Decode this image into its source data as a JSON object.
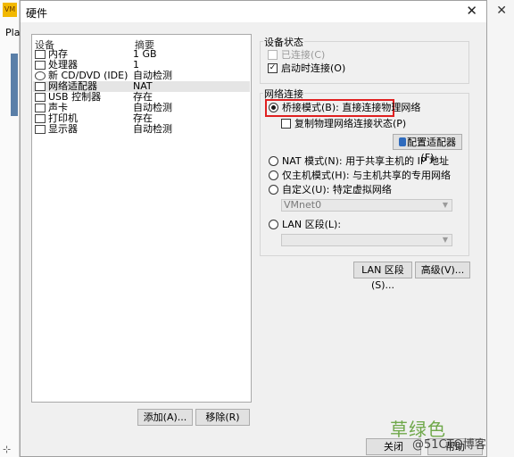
{
  "dialog": {
    "title": "硬件"
  },
  "background": {
    "left_text": "Pla",
    "cursor": "⊹"
  },
  "device_list": {
    "header": {
      "device": "设备",
      "summary": "摘要"
    },
    "rows": [
      {
        "name": "内存",
        "summary": "1 GB",
        "icon": "memory-icon"
      },
      {
        "name": "处理器",
        "summary": "1",
        "icon": "processor-icon"
      },
      {
        "name": "新 CD/DVD (IDE)",
        "summary": "自动检测",
        "icon": "cd-dvd-icon"
      },
      {
        "name": "网络适配器",
        "summary": "NAT",
        "icon": "network-adapter-icon",
        "selected": true
      },
      {
        "name": "USB 控制器",
        "summary": "存在",
        "icon": "usb-icon"
      },
      {
        "name": "声卡",
        "summary": "自动检测",
        "icon": "sound-card-icon"
      },
      {
        "name": "打印机",
        "summary": "存在",
        "icon": "printer-icon"
      },
      {
        "name": "显示器",
        "summary": "自动检测",
        "icon": "display-icon"
      }
    ],
    "add_label": "添加(A)...",
    "remove_label": "移除(R)"
  },
  "device_status": {
    "title": "设备状态",
    "connected": "已连接(C)",
    "connect_on_power_on": "启动时连接(O)"
  },
  "network": {
    "title": "网络连接",
    "bridged": "桥接模式(B): 直接连接物理网络",
    "replicate": "复制物理网络连接状态(P)",
    "configure_adapters": "配置适配器(F)",
    "nat": "NAT 模式(N): 用于共享主机的 IP 地址",
    "host_only": "仅主机模式(H): 与主机共享的专用网络",
    "custom": "自定义(U): 特定虚拟网络",
    "vmnet_value": "VMnet0",
    "lan_segment": "LAN 区段(L):",
    "lan_segment_value": ""
  },
  "buttons": {
    "lan_segments": "LAN 区段(S)...",
    "advanced": "高级(V)...",
    "close": "关闭",
    "help": "帮助"
  },
  "watermark": {
    "line1": "草绿色",
    "line2": "@51CTO博客"
  },
  "colors": {
    "highlight": "#e02020",
    "selected_row": "#e5e5e5"
  }
}
